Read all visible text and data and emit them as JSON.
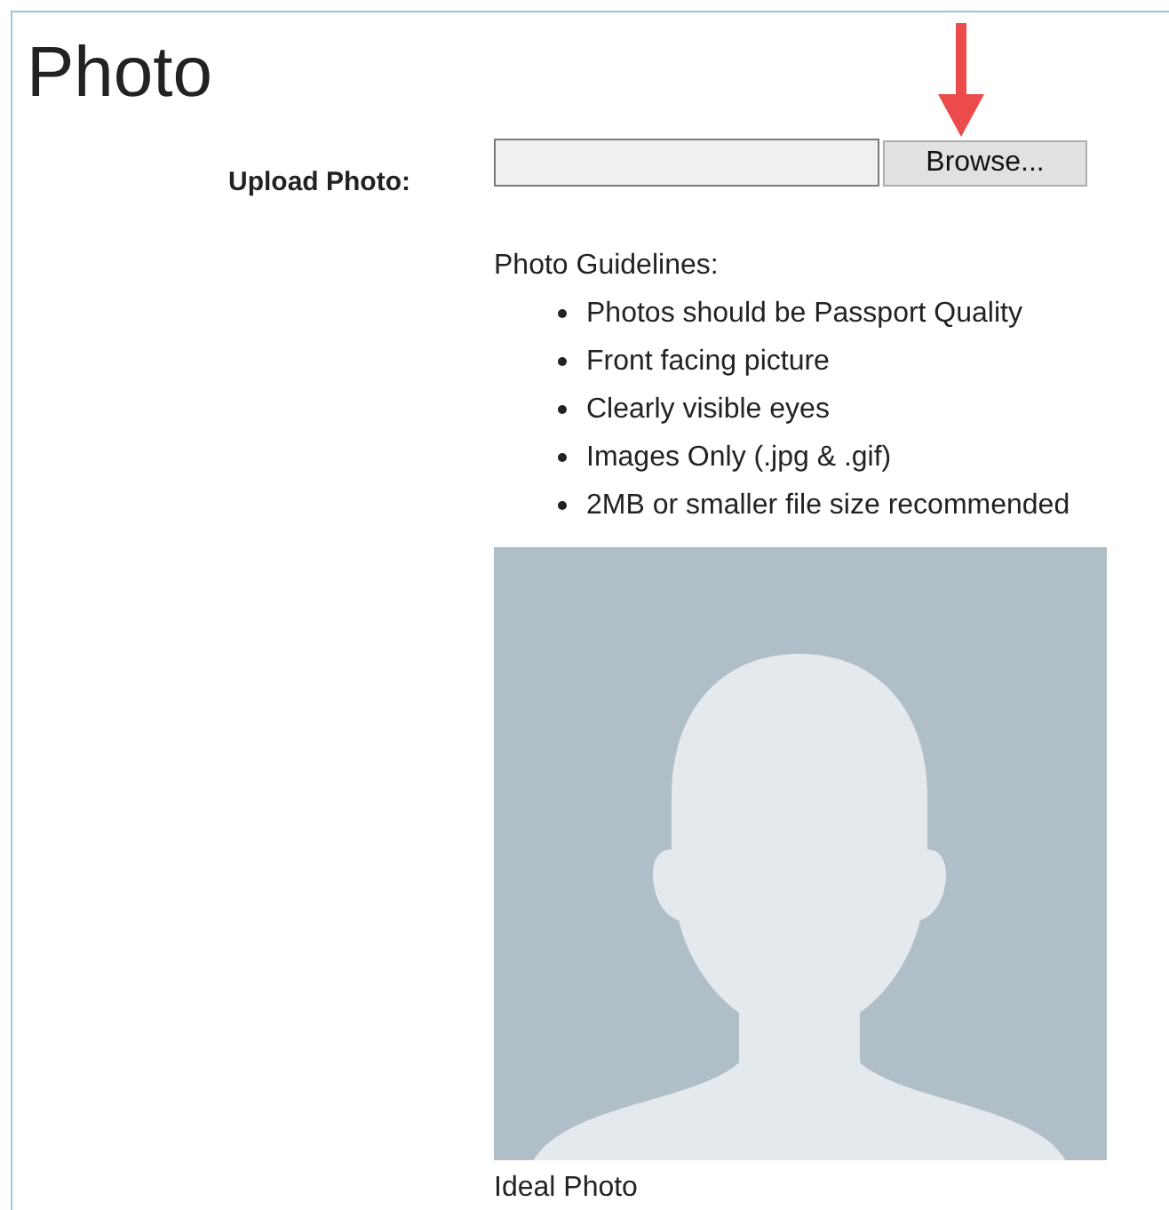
{
  "title": "Photo",
  "upload": {
    "label": "Upload Photo:",
    "button": "Browse..."
  },
  "guidelines": {
    "heading": "Photo Guidelines:",
    "items": [
      "Photos should be Passport Quality",
      "Front facing picture",
      "Clearly visible eyes",
      "Images Only (.jpg & .gif)",
      "2MB or smaller file size recommended"
    ]
  },
  "sample": {
    "caption": "Ideal Photo"
  }
}
